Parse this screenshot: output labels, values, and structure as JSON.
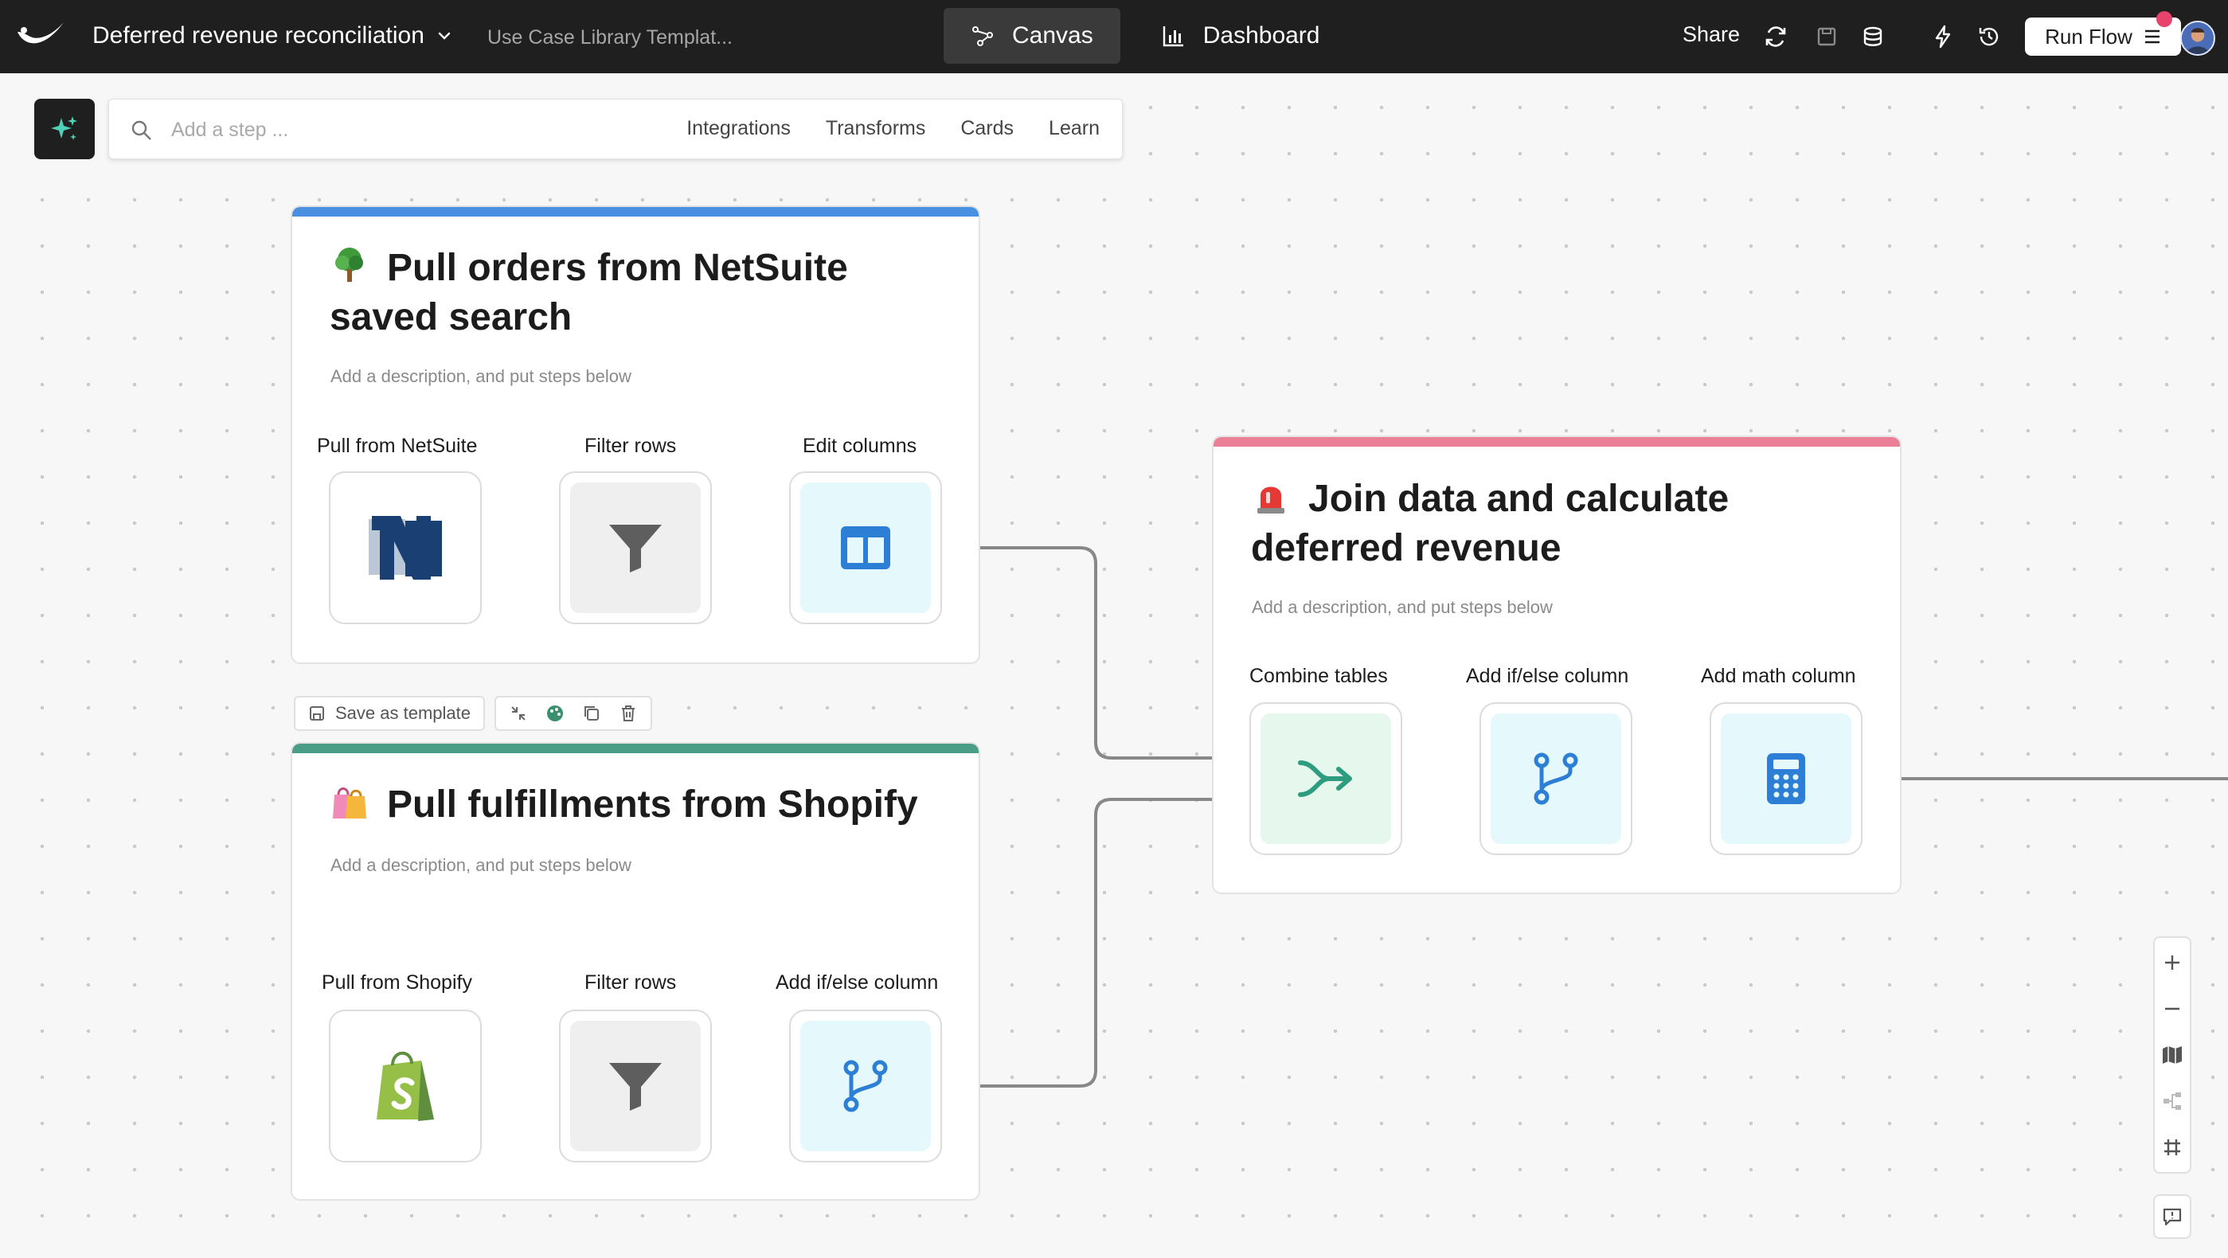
{
  "header": {
    "flow_title": "Deferred revenue reconciliation",
    "template_name": "Use Case Library Templat...",
    "tabs": [
      {
        "label": "Canvas",
        "active": true
      },
      {
        "label": "Dashboard",
        "active": false
      }
    ],
    "share_label": "Share",
    "run_label": "Run Flow",
    "icons": [
      "refresh-icon",
      "save-icon",
      "database-icon",
      "bolt-icon",
      "history-icon"
    ]
  },
  "search": {
    "placeholder": "Add a step ...",
    "links": [
      "Integrations",
      "Transforms",
      "Cards",
      "Learn"
    ]
  },
  "groups": {
    "netsuite": {
      "title": "Pull orders from NetSuite saved search",
      "description": "Add a description, and put steps below",
      "band_color": "#4a90e2",
      "emoji": "tree",
      "steps": [
        "Pull from NetSuite",
        "Filter rows",
        "Edit columns"
      ]
    },
    "shopify": {
      "title": "Pull fulfillments from Shopify",
      "description": "Add a description, and put steps below",
      "band_color": "#4a9d86",
      "emoji": "shopping-bags",
      "steps": [
        "Pull from Shopify",
        "Filter rows",
        "Add if/else column"
      ]
    },
    "join": {
      "title": "Join data and calculate deferred revenue",
      "description": "Add a description, and put steps below",
      "band_color": "#ea7f97",
      "emoji": "siren",
      "steps": [
        "Combine tables",
        "Add if/else column",
        "Add math column"
      ]
    }
  },
  "template_toolbar": {
    "save_label": "Save as template",
    "icons": [
      "collapse-icon",
      "palette-icon",
      "copy-icon",
      "trash-icon"
    ]
  },
  "zoom_controls": [
    "zoom-in-icon",
    "zoom-out-icon",
    "map-icon",
    "tree-layout-icon",
    "frame-icon"
  ],
  "colors": {
    "topbar": "#1f1f1f",
    "accent_blue": "#4a90e2",
    "accent_green": "#4a9d86",
    "accent_pink": "#ea7f97"
  }
}
